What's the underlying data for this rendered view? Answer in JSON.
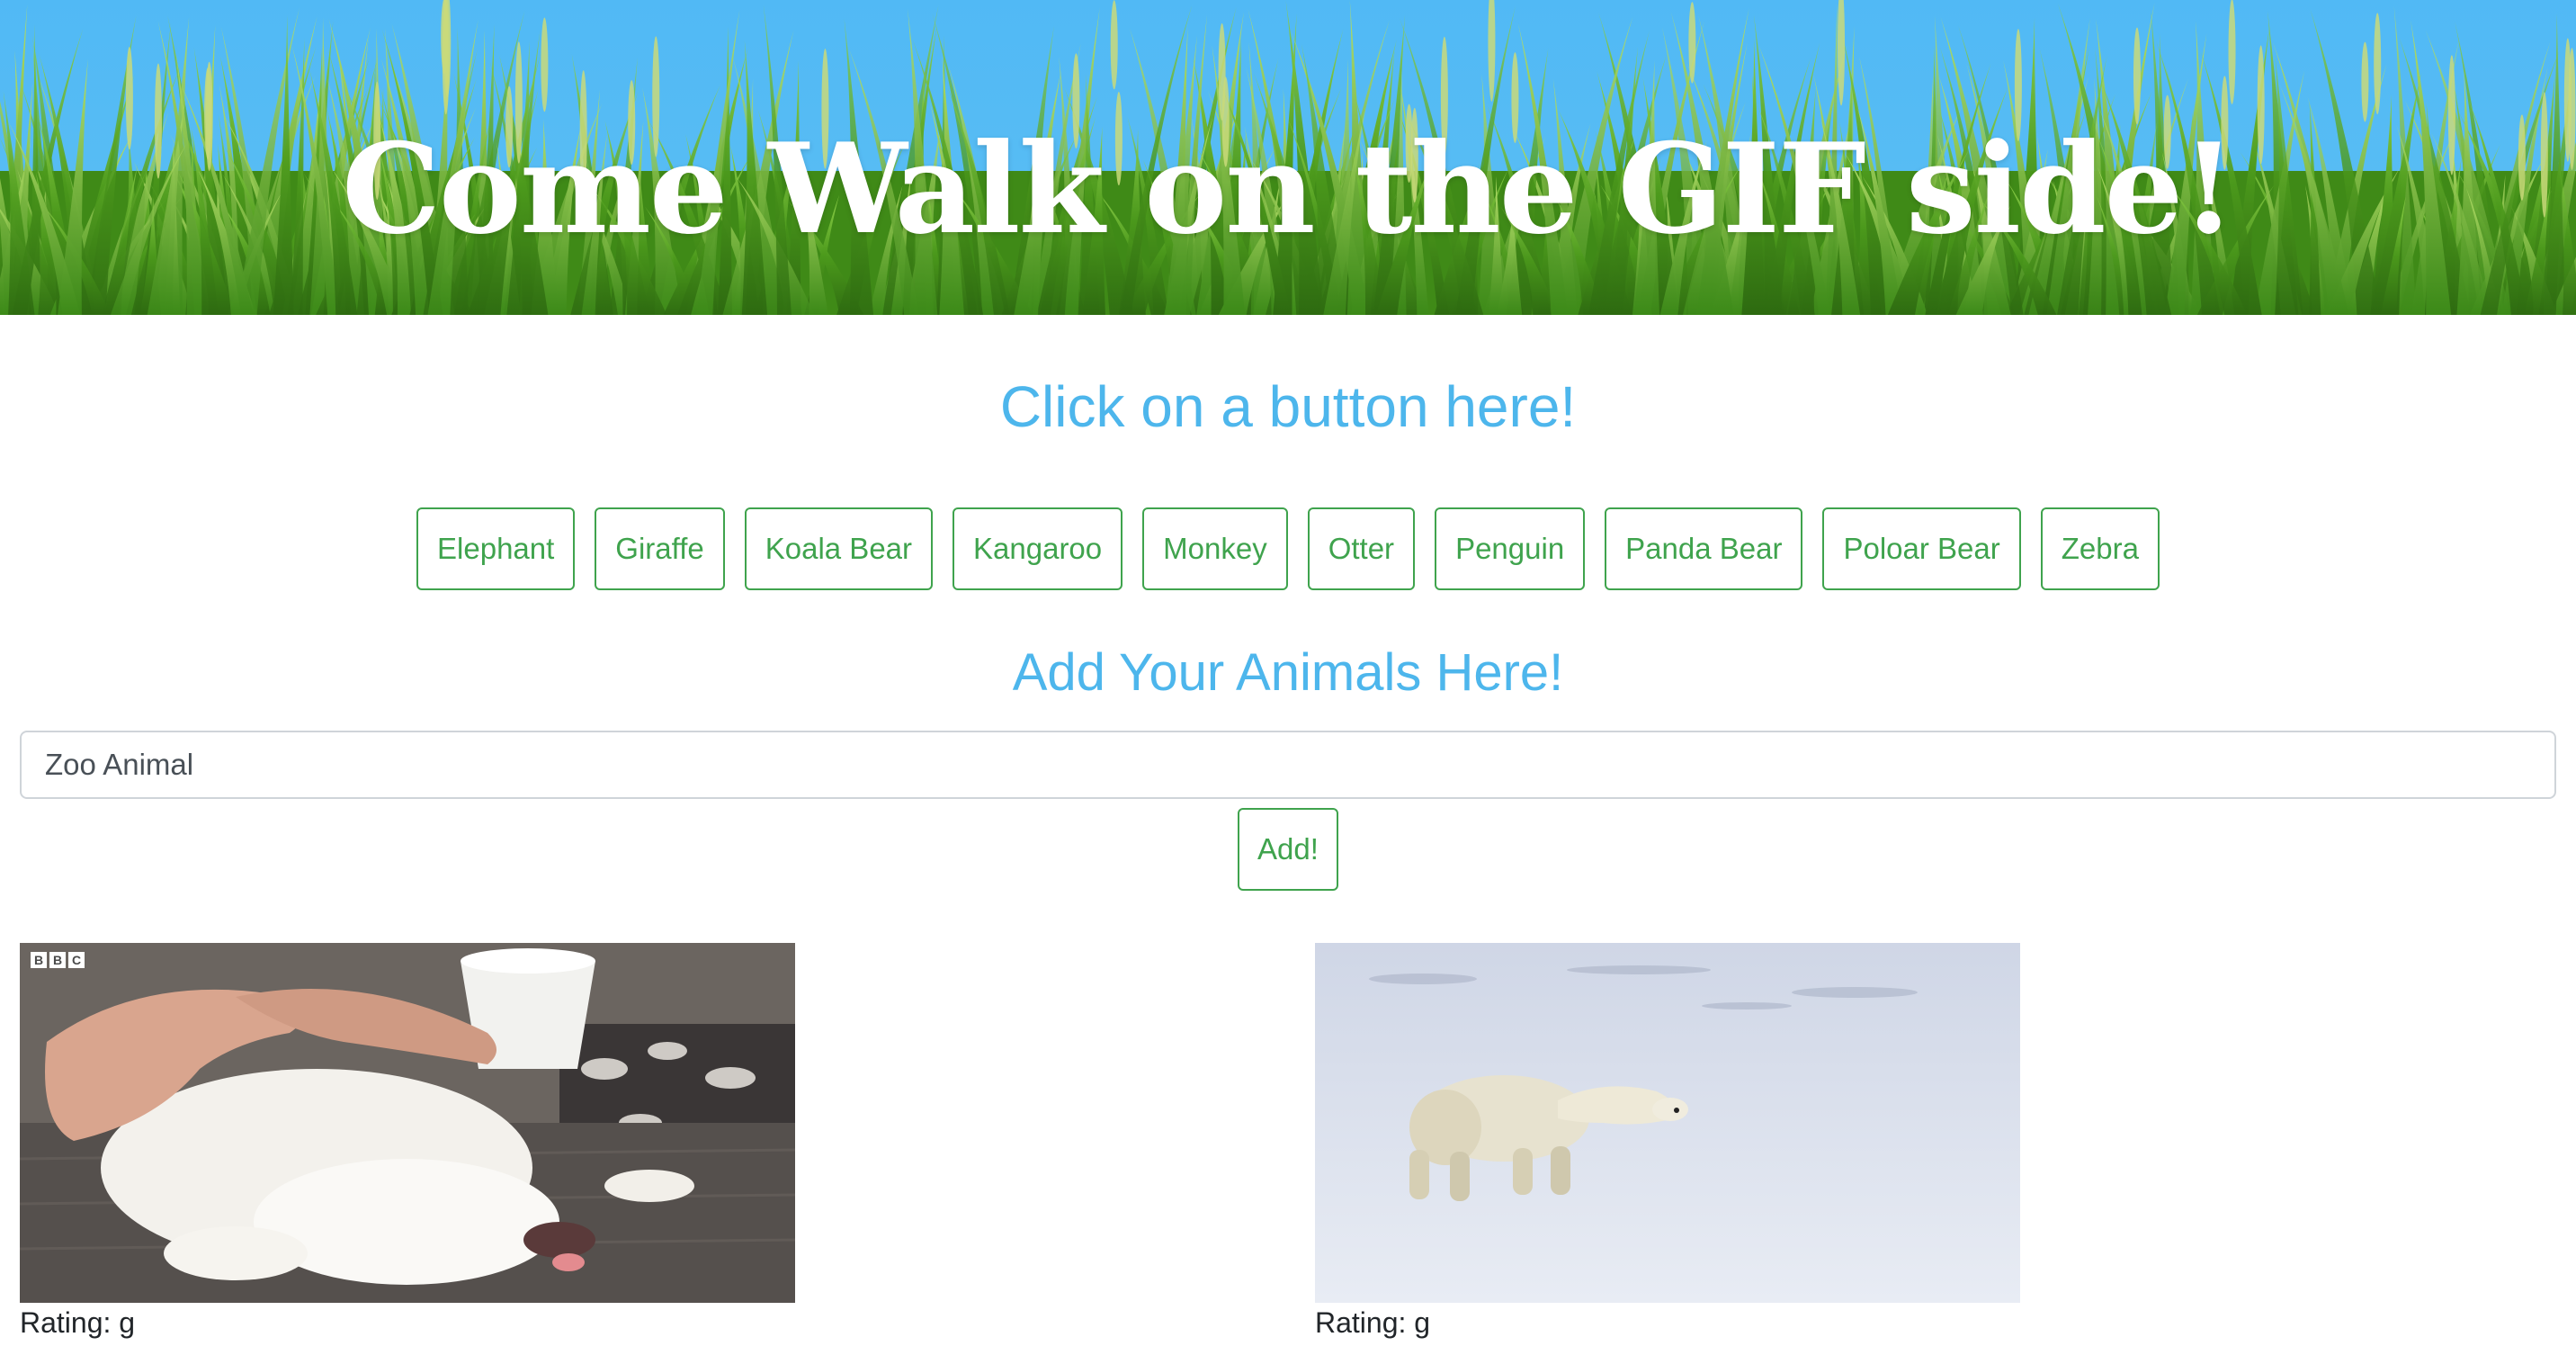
{
  "banner": {
    "title": "Come Walk on the GIF side!"
  },
  "buttons_section": {
    "heading": "Click on a button here!",
    "buttons": [
      {
        "label": "Elephant"
      },
      {
        "label": "Giraffe"
      },
      {
        "label": "Koala Bear"
      },
      {
        "label": "Kangaroo"
      },
      {
        "label": "Monkey"
      },
      {
        "label": "Otter"
      },
      {
        "label": "Penguin"
      },
      {
        "label": "Panda Bear"
      },
      {
        "label": "Poloar Bear"
      },
      {
        "label": "Zebra"
      }
    ]
  },
  "add_section": {
    "heading": "Add Your Animals Here!",
    "input_placeholder": "Zoo Animal",
    "add_label": "Add!"
  },
  "gifs": [
    {
      "rating": "Rating: g",
      "logo": [
        "B",
        "B",
        "C"
      ],
      "subject": "polar-bear-cub-gif"
    },
    {
      "rating": "Rating: g",
      "subject": "polar-bear-walking-gif"
    }
  ],
  "colors": {
    "sky": "#51b9f5",
    "heading_blue": "#4db6ec",
    "button_green": "#3fa34d",
    "grass_green": "#4c9a1c"
  }
}
